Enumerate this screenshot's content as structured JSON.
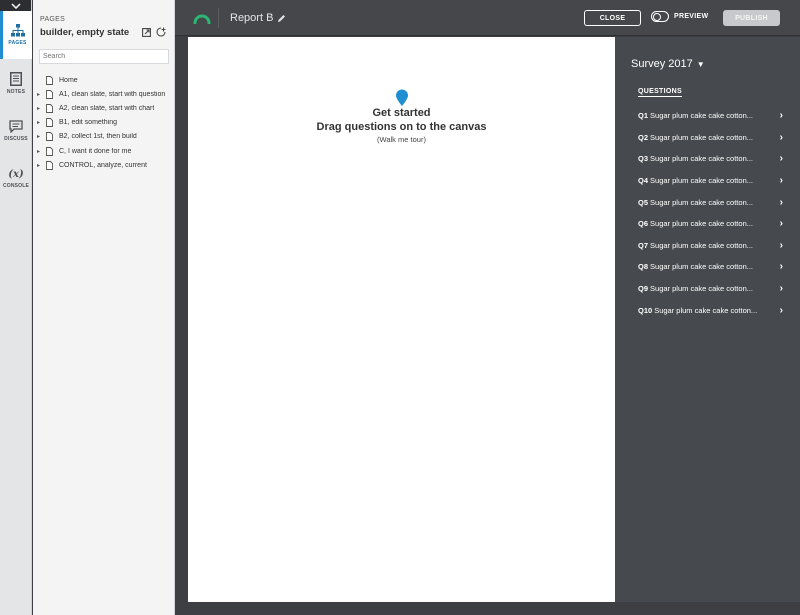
{
  "rail": {
    "items": [
      {
        "label": "PAGES",
        "icon": "sitemap-icon",
        "active": true
      },
      {
        "label": "NOTES",
        "icon": "notes-icon",
        "active": false
      },
      {
        "label": "DISCUSS",
        "icon": "discuss-icon",
        "active": false
      },
      {
        "label": "CONSOLE",
        "icon": "console-icon",
        "active": false
      }
    ],
    "console_glyph": "(x)"
  },
  "pages": {
    "kicker": "PAGES",
    "title": "builder, empty state",
    "search_placeholder": "Search",
    "items": [
      {
        "label": "Home",
        "expandable": false
      },
      {
        "label": "A1, clean slate, start with question",
        "expandable": true
      },
      {
        "label": "A2, clean slate, start with chart",
        "expandable": true
      },
      {
        "label": "B1, edit something",
        "expandable": true
      },
      {
        "label": "B2, collect 1st, then build",
        "expandable": true
      },
      {
        "label": "C, I want it done for me",
        "expandable": true
      },
      {
        "label": "CONTROL, analyze, current",
        "expandable": true
      }
    ]
  },
  "topbar": {
    "report_title": "Report B",
    "close_label": "CLOSE",
    "preview_label": "PREVIEW",
    "publish_label": "PUBLISH"
  },
  "canvas": {
    "title": "Get started",
    "subtitle": "Drag questions on to the canvas",
    "link": "(Walk me tour)"
  },
  "questions_panel": {
    "survey": "Survey 2017",
    "heading": "QUESTIONS",
    "items": [
      {
        "num": "Q1",
        "text": "Sugar plum cake cake cotton..."
      },
      {
        "num": "Q2",
        "text": "Sugar plum cake cake cotton..."
      },
      {
        "num": "Q3",
        "text": "Sugar plum cake cake cotton..."
      },
      {
        "num": "Q4",
        "text": "Sugar plum cake cake cotton..."
      },
      {
        "num": "Q5",
        "text": "Sugar plum cake cake cotton..."
      },
      {
        "num": "Q6",
        "text": "Sugar plum cake cake cotton..."
      },
      {
        "num": "Q7",
        "text": "Sugar plum cake cake cotton..."
      },
      {
        "num": "Q8",
        "text": "Sugar plum cake cake cotton..."
      },
      {
        "num": "Q9",
        "text": "Sugar plum cake cake cotton..."
      },
      {
        "num": "Q10",
        "text": "Sugar plum cake cake cotton..."
      }
    ]
  },
  "colors": {
    "accent": "#1f8fd1",
    "logo": "#2bb673",
    "dark": "#45474b"
  }
}
